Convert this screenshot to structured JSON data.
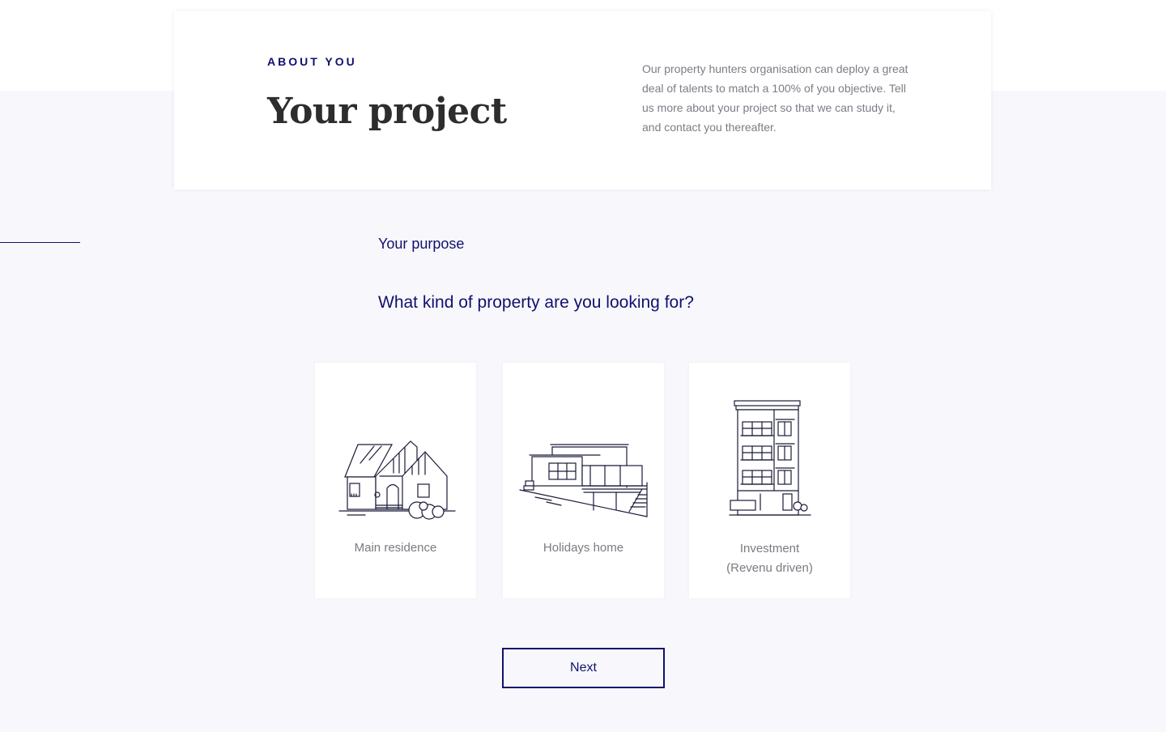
{
  "header": {
    "eyebrow": "ABOUT YOU",
    "title": "Your project",
    "intro": "Our property hunters organisation can deploy a great deal of talents to match a 100% of you objective. Tell us more about your project  so that we can study it, and contact you thereafter."
  },
  "section": {
    "label": "Your purpose",
    "question": "What kind of property are you looking for?"
  },
  "options": [
    {
      "label": "Main residence",
      "icon": "house-icon"
    },
    {
      "label": "Holidays home",
      "icon": "villa-icon"
    },
    {
      "label_line1": "Investment",
      "label_line2": "(Revenu driven)",
      "icon": "apartment-building-icon"
    }
  ],
  "actions": {
    "next_label": "Next"
  },
  "colors": {
    "accent": "#10116e",
    "background": "#f8f8fc",
    "card": "#ffffff",
    "muted_text": "#7c7c86",
    "title_text": "#2d2d2d"
  }
}
